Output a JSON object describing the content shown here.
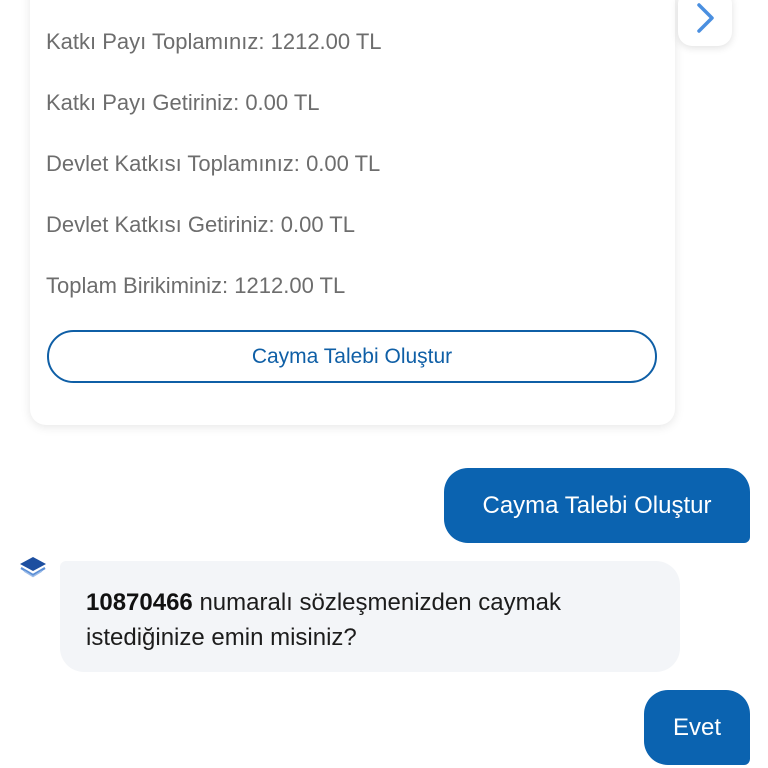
{
  "summary_card": {
    "lines": [
      {
        "label": "Katkı Payı Toplamınız:",
        "value": "1212.00 TL"
      },
      {
        "label": "Katkı Payı Getiriniz:",
        "value": "0.00 TL"
      },
      {
        "label": "Devlet Katkısı Toplamınız:",
        "value": "0.00 TL"
      },
      {
        "label": "Devlet Katkısı Getiriniz:",
        "value": "0.00 TL"
      },
      {
        "label": "Toplam Birikiminiz:",
        "value": "1212.00 TL"
      }
    ],
    "action_label": "Cayma Talebi Oluştur"
  },
  "carousel": {
    "next_icon": "chevron-right-icon"
  },
  "messages": {
    "user_1": "Cayma Talebi Oluştur",
    "bot_1": {
      "contract_number": "10870466",
      "text": "numaralı sözleşmenizden caymak istediğinize emin misiniz?"
    },
    "user_2": "Evet"
  },
  "colors": {
    "primary": "#0b63b0",
    "primary_outline": "#0f5fa6",
    "bot_bubble_bg": "#f3f5f8",
    "muted_text": "#6d6d6d",
    "chevron": "#4a8fe0"
  },
  "bot_avatar_icon": "layers-logo-icon"
}
